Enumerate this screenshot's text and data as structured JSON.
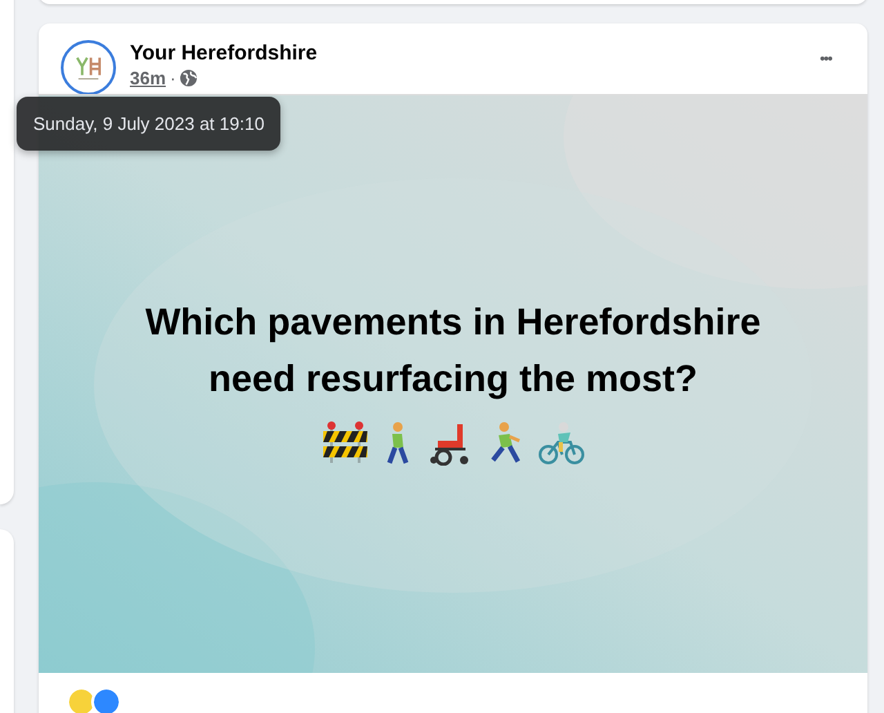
{
  "post": {
    "page_name": "Your Herefordshire",
    "time": "36m",
    "separator": "·",
    "tooltip": "Sunday, 9 July 2023 at 19:10",
    "more": "•••",
    "image_text": [
      "Which pavements in Herefordshire",
      "need resurfacing the most?"
    ]
  }
}
